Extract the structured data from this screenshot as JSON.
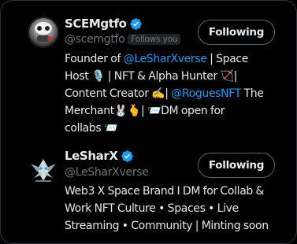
{
  "users": [
    {
      "name": "SCEMgtfo",
      "handle": "@scemgtfo",
      "follows_you": "Follows you",
      "button": "Following",
      "bio": {
        "l1_a": "Founder of ",
        "l1_mention": "@LeSharXverse",
        "l1_b": " | Space",
        "l2": "Host 🎙️ | NFT & Alpha Hunter 🏹|",
        "l3_a": "Content Creator ✍️| ",
        "l3_mention": "@RoguesNFT",
        "l3_b": " The",
        "l4": "Merchant🐰🫰| 📨DM open for",
        "l5": "collabs 📨"
      }
    },
    {
      "name": "LeSharX",
      "handle": "@LeSharXverse",
      "button": "Following",
      "bio": {
        "l1": "Web3 X Space Brand I DM for Collab &",
        "l2": "Work NFT Culture • Spaces • Live",
        "l3": "Streaming • Community | Minting soon"
      }
    }
  ],
  "colors": {
    "background": "#000000",
    "text": "#e7e9ea",
    "secondary": "#71767b",
    "link": "#1d9bf0",
    "verified": "#1d9bf0",
    "border": "#536471"
  }
}
